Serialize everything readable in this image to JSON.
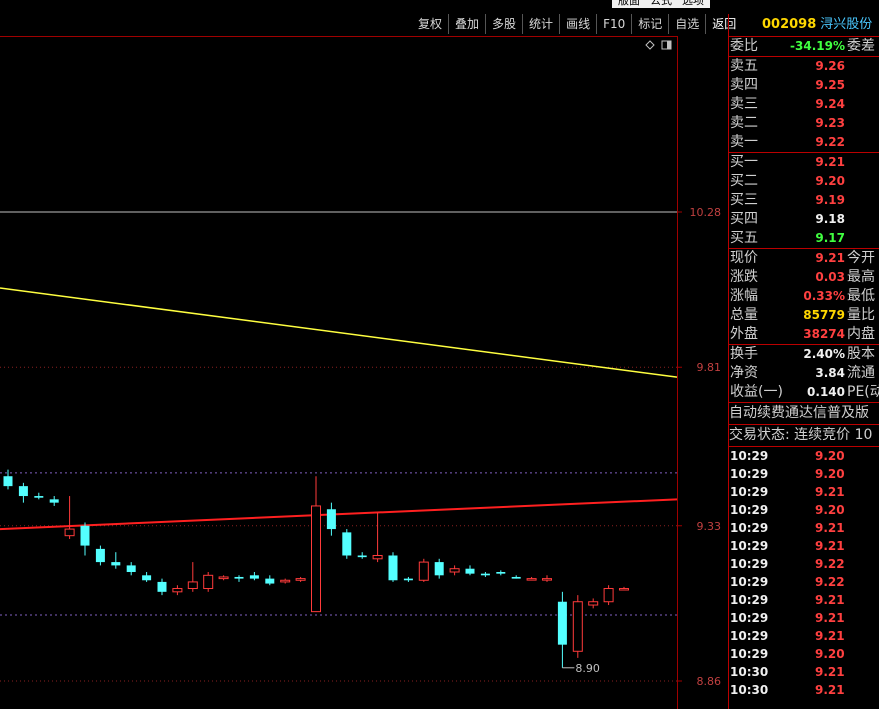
{
  "top_menu": [
    "版面",
    "公式",
    "选项"
  ],
  "toolbar": [
    "复权",
    "叠加",
    "多股",
    "统计",
    "画线",
    "F10",
    "标记",
    "自选",
    "返回"
  ],
  "stock": {
    "code": "002098",
    "name": "浔兴股份"
  },
  "weibi": {
    "label": "委比",
    "value": "-34.19%",
    "label2": "委差"
  },
  "sell": [
    {
      "label": "卖五",
      "price": "9.26"
    },
    {
      "label": "卖四",
      "price": "9.25"
    },
    {
      "label": "卖三",
      "price": "9.24"
    },
    {
      "label": "卖二",
      "price": "9.23"
    },
    {
      "label": "卖一",
      "price": "9.22"
    }
  ],
  "buy": [
    {
      "label": "买一",
      "price": "9.21"
    },
    {
      "label": "买二",
      "price": "9.20"
    },
    {
      "label": "买三",
      "price": "9.19"
    },
    {
      "label": "买四",
      "price": "9.18"
    },
    {
      "label": "买五",
      "price": "9.17"
    }
  ],
  "quote": [
    {
      "label": "现价",
      "value": "9.21",
      "label2": "今开",
      "color": "red"
    },
    {
      "label": "涨跌",
      "value": "0.03",
      "label2": "最高",
      "color": "red"
    },
    {
      "label": "涨幅",
      "value": "0.33%",
      "label2": "最低",
      "color": "red"
    },
    {
      "label": "总量",
      "value": "85779",
      "label2": "量比",
      "color": "yellow"
    },
    {
      "label": "外盘",
      "value": "38274",
      "label2": "内盘",
      "color": "red"
    }
  ],
  "fundamentals": [
    {
      "label": "换手",
      "value": "2.40%",
      "label2": "股本"
    },
    {
      "label": "净资",
      "value": "3.84",
      "label2": "流通"
    },
    {
      "label": "收益(一)",
      "value": "0.140",
      "label2": "PE(动"
    }
  ],
  "banner": "自动续费通达信普及版",
  "trade_status": "交易状态: 连续竞价 10",
  "ticks": [
    {
      "time": "10:29",
      "price": "9.20"
    },
    {
      "time": "10:29",
      "price": "9.20"
    },
    {
      "time": "10:29",
      "price": "9.21"
    },
    {
      "time": "10:29",
      "price": "9.20"
    },
    {
      "time": "10:29",
      "price": "9.21"
    },
    {
      "time": "10:29",
      "price": "9.21"
    },
    {
      "time": "10:29",
      "price": "9.22"
    },
    {
      "time": "10:29",
      "price": "9.22"
    },
    {
      "time": "10:29",
      "price": "9.21"
    },
    {
      "time": "10:29",
      "price": "9.21"
    },
    {
      "time": "10:29",
      "price": "9.21"
    },
    {
      "time": "10:29",
      "price": "9.20"
    },
    {
      "time": "10:30",
      "price": "9.21"
    },
    {
      "time": "10:30",
      "price": "9.21"
    }
  ],
  "chart_data": {
    "type": "candlestick",
    "y_ticks": [
      "10.28",
      "9.81",
      "9.33",
      "8.86"
    ],
    "y_tick_values": [
      10.28,
      9.81,
      9.33,
      8.86
    ],
    "low_marker": "8.90",
    "colors": {
      "up": "#ff3b3b",
      "down": "#54ffff",
      "ma_yellow": "#ffff40",
      "ma_red": "#ff2020"
    },
    "ma_yellow": [
      10.05,
      9.78
    ],
    "ma_red": [
      9.32,
      9.41
    ],
    "candles": [
      {
        "o": 9.48,
        "h": 9.5,
        "l": 9.44,
        "c": 9.45
      },
      {
        "o": 9.45,
        "h": 9.46,
        "l": 9.4,
        "c": 9.42
      },
      {
        "o": 9.42,
        "h": 9.43,
        "l": 9.41,
        "c": 9.415
      },
      {
        "o": 9.41,
        "h": 9.42,
        "l": 9.39,
        "c": 9.4
      },
      {
        "o": 9.3,
        "h": 9.42,
        "l": 9.29,
        "c": 9.32
      },
      {
        "o": 9.33,
        "h": 9.34,
        "l": 9.24,
        "c": 9.27
      },
      {
        "o": 9.26,
        "h": 9.27,
        "l": 9.21,
        "c": 9.22
      },
      {
        "o": 9.22,
        "h": 9.25,
        "l": 9.2,
        "c": 9.21
      },
      {
        "o": 9.21,
        "h": 9.22,
        "l": 9.18,
        "c": 9.19
      },
      {
        "o": 9.18,
        "h": 9.19,
        "l": 9.16,
        "c": 9.165
      },
      {
        "o": 9.16,
        "h": 9.17,
        "l": 9.12,
        "c": 9.13
      },
      {
        "o": 9.13,
        "h": 9.15,
        "l": 9.12,
        "c": 9.14
      },
      {
        "o": 9.14,
        "h": 9.22,
        "l": 9.13,
        "c": 9.16
      },
      {
        "o": 9.14,
        "h": 9.19,
        "l": 9.13,
        "c": 9.18
      },
      {
        "o": 9.17,
        "h": 9.18,
        "l": 9.165,
        "c": 9.175
      },
      {
        "o": 9.175,
        "h": 9.18,
        "l": 9.16,
        "c": 9.17
      },
      {
        "o": 9.18,
        "h": 9.19,
        "l": 9.165,
        "c": 9.17
      },
      {
        "o": 9.17,
        "h": 9.18,
        "l": 9.15,
        "c": 9.155
      },
      {
        "o": 9.16,
        "h": 9.17,
        "l": 9.155,
        "c": 9.165
      },
      {
        "o": 9.165,
        "h": 9.175,
        "l": 9.16,
        "c": 9.17
      },
      {
        "o": 9.07,
        "h": 9.48,
        "l": 9.07,
        "c": 9.39
      },
      {
        "o": 9.38,
        "h": 9.4,
        "l": 9.3,
        "c": 9.32
      },
      {
        "o": 9.31,
        "h": 9.32,
        "l": 9.23,
        "c": 9.24
      },
      {
        "o": 9.24,
        "h": 9.25,
        "l": 9.23,
        "c": 9.235
      },
      {
        "o": 9.23,
        "h": 9.37,
        "l": 9.22,
        "c": 9.24
      },
      {
        "o": 9.24,
        "h": 9.25,
        "l": 9.16,
        "c": 9.165
      },
      {
        "o": 9.17,
        "h": 9.175,
        "l": 9.16,
        "c": 9.165
      },
      {
        "o": 9.165,
        "h": 9.23,
        "l": 9.16,
        "c": 9.22
      },
      {
        "o": 9.22,
        "h": 9.23,
        "l": 9.17,
        "c": 9.18
      },
      {
        "o": 9.19,
        "h": 9.21,
        "l": 9.18,
        "c": 9.2
      },
      {
        "o": 9.2,
        "h": 9.21,
        "l": 9.18,
        "c": 9.185
      },
      {
        "o": 9.185,
        "h": 9.19,
        "l": 9.175,
        "c": 9.18
      },
      {
        "o": 9.19,
        "h": 9.195,
        "l": 9.18,
        "c": 9.185
      },
      {
        "o": 9.175,
        "h": 9.18,
        "l": 9.17,
        "c": 9.17
      },
      {
        "o": 9.17,
        "h": 9.175,
        "l": 9.165,
        "c": 9.17
      },
      {
        "o": 9.17,
        "h": 9.18,
        "l": 9.16,
        "c": 9.17
      },
      {
        "o": 9.1,
        "h": 9.13,
        "l": 8.9,
        "c": 8.97
      },
      {
        "o": 8.95,
        "h": 9.12,
        "l": 8.93,
        "c": 9.1
      },
      {
        "o": 9.09,
        "h": 9.11,
        "l": 9.08,
        "c": 9.1
      },
      {
        "o": 9.1,
        "h": 9.15,
        "l": 9.09,
        "c": 9.14
      },
      {
        "o": 9.14,
        "h": 9.145,
        "l": 9.135,
        "c": 9.14
      }
    ]
  }
}
